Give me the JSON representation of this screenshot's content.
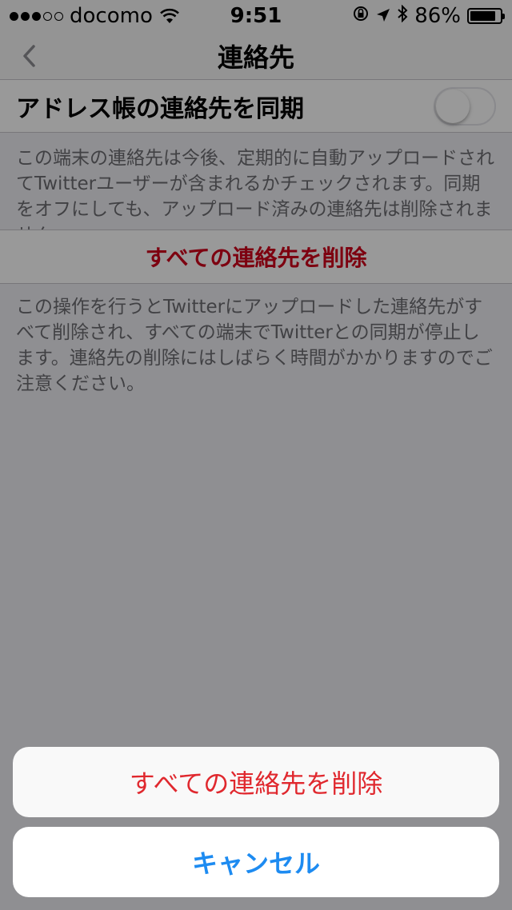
{
  "status_bar": {
    "carrier": "docomo",
    "time": "9:51",
    "battery": "86%",
    "battery_level": 0.86,
    "signal_strength": 3,
    "signal_max": 5,
    "icons": [
      "wifi-icon",
      "orientation-lock-icon",
      "location-icon",
      "bluetooth-icon",
      "battery-icon"
    ]
  },
  "nav": {
    "title": "連絡先",
    "back_icon": "chevron-left-icon"
  },
  "sync": {
    "label": "アドレス帳の連絡先を同期",
    "enabled": false
  },
  "sync_description": "この端末の連絡先は今後、定期的に自動アップロードされてTwitterユーザーが含まれるかチェックされます。同期をオフにしても、アップロード済みの連絡先は削除されません。",
  "delete": {
    "label": "すべての連絡先を削除"
  },
  "delete_description": "この操作を行うとTwitterにアップロードした連絡先がすべて削除され、すべての端末でTwitterとの同期が停止します。連絡先の削除にはしばらく時間がかかりますのでご注意ください。",
  "action_sheet": {
    "delete_label": "すべての連絡先を削除",
    "cancel_label": "キャンセル"
  },
  "colors": {
    "destructive": "#d0021b",
    "sheet_destructive": "#e0282e",
    "cancel_blue": "#1d8bf1",
    "overlay": "rgba(0,0,0,0.4)"
  }
}
